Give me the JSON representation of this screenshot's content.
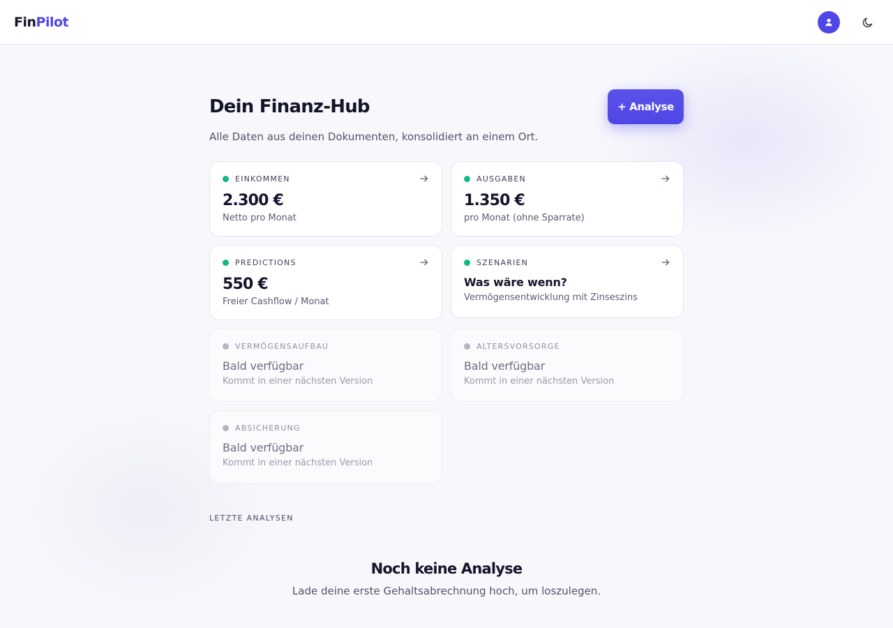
{
  "header": {
    "logo_part1": "Fin",
    "logo_part2": "Pilot",
    "avatar_icon": "user-icon",
    "theme_icon": "moon-icon"
  },
  "hub": {
    "title": "Dein Finanz-Hub",
    "add_button_label": "+ Analyse",
    "subtitle": "Alle Daten aus deinen Dokumenten, konsolidiert an einem Ort."
  },
  "cards": [
    {
      "label": "EINKOMMEN",
      "value": "2.300 €",
      "desc": "Netto pro Monat",
      "status": "active"
    },
    {
      "label": "AUSGABEN",
      "value": "1.350 €",
      "desc": "pro Monat (ohne Sparrate)",
      "status": "active"
    },
    {
      "label": "PREDICTIONS",
      "value": "550 €",
      "desc": "Freier Cashflow / Monat",
      "status": "active"
    },
    {
      "label": "SZENARIEN",
      "heading": "Was wäre wenn?",
      "desc": "Vermögensentwicklung mit Zinseszins",
      "status": "active"
    },
    {
      "label": "VERMÖGENSAUFBAU",
      "heading": "Bald verfügbar",
      "desc": "Kommt in einer nächsten Version",
      "status": "disabled"
    },
    {
      "label": "ALTERSVORSORGE",
      "heading": "Bald verfügbar",
      "desc": "Kommt in einer nächsten Version",
      "status": "disabled"
    },
    {
      "label": "ABSICHERUNG",
      "heading": "Bald verfügbar",
      "desc": "Kommt in einer nächsten Version",
      "status": "disabled"
    }
  ],
  "recent": {
    "section_label": "LETZTE ANALYSEN",
    "empty_title": "Noch keine Analyse",
    "empty_desc": "Lade deine erste Gehaltsabrechnung hoch, um loszulegen."
  },
  "colors": {
    "accent": "#4f46e5",
    "active_dot": "#10b981",
    "inactive_dot": "#b4b4c2"
  }
}
